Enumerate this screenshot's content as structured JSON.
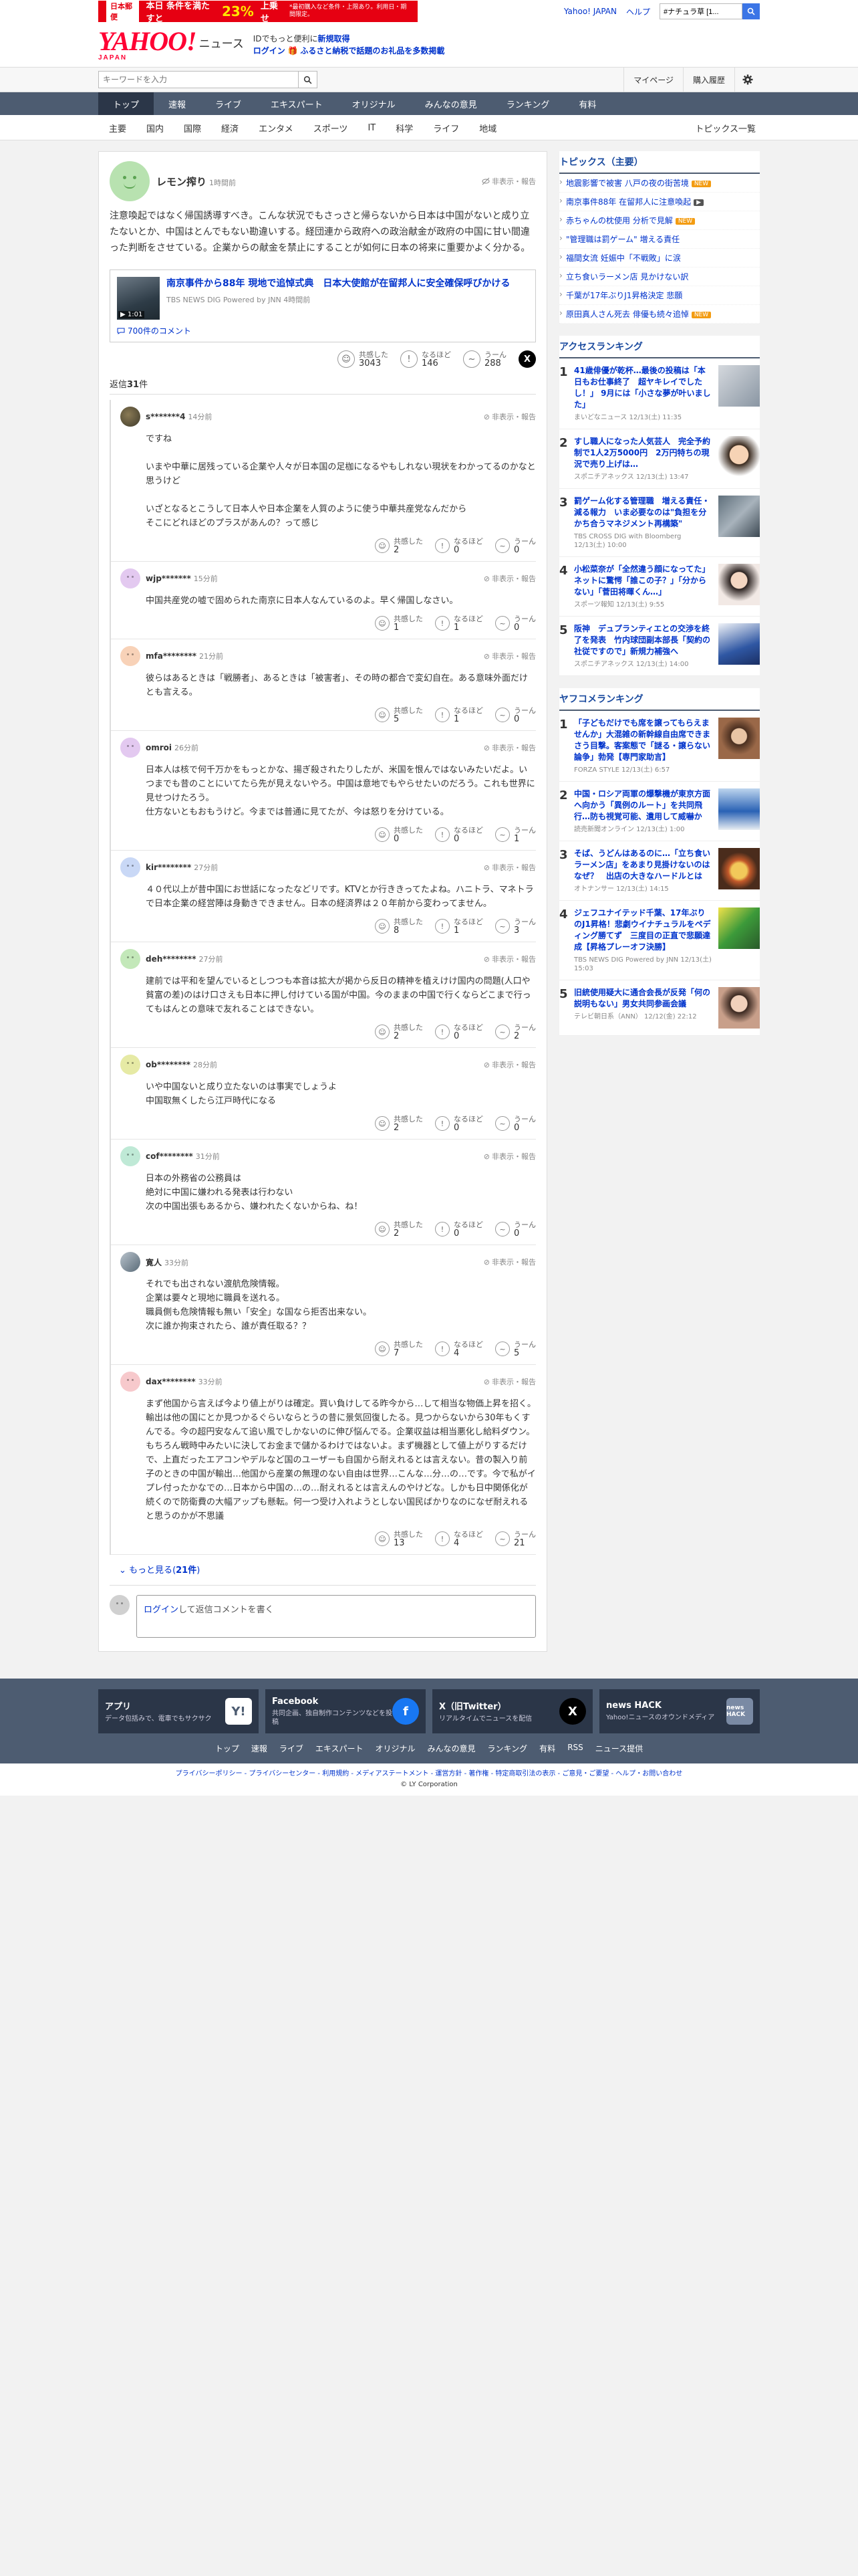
{
  "promo": {
    "badge": "日本郵便",
    "text": "本日 条件を満たすと",
    "pct": "23%",
    "tail": "上乗せ",
    "note": "*最初購入など条件・上限あり。利用日・期間限定。"
  },
  "top": {
    "yahoo_japan": "Yahoo! JAPAN",
    "help": "ヘルプ",
    "search_placeholder": "ウェブ検索",
    "search_value": "#ナチュラ草 [1..."
  },
  "masthead": {
    "logo": "YAHOO!",
    "logo_sub": "JAPAN",
    "section": "ニュース",
    "line1_pre": "IDでもっと便利に",
    "line1_link": "新規取得",
    "line2_login": "ログイン",
    "line2_text": "ふるさと納税で話題のお礼品を多数掲載"
  },
  "search": {
    "placeholder": "キーワードを入力",
    "mypage": "マイページ",
    "history": "購入履歴"
  },
  "nav": [
    "トップ",
    "速報",
    "ライブ",
    "エキスパート",
    "オリジナル",
    "みんなの意見",
    "ランキング",
    "有料"
  ],
  "subnav": [
    "主要",
    "国内",
    "国際",
    "経済",
    "エンタメ",
    "スポーツ",
    "IT",
    "科学",
    "ライフ",
    "地域"
  ],
  "subnav_right": "トピックス一覧",
  "post": {
    "user": "レモン搾り",
    "time": "1時間前",
    "report": "非表示・報告",
    "body": "注意喚起ではなく帰国誘導すべき。こんな状況でもさっさと帰らないから日本は中国がないと成り立たないとか、中国はとんでもない勘違いする。経団連から政府への政治献金が政府の中国に甘い間違った判断をさせている。企業からの献金を禁止にすることが如何に日本の将来に重要かよく分かる。",
    "article_title": "南京事件から88年 現地で追悼式典　日本大使館が在留邦人に安全確保呼びかける",
    "article_duration": "1:01",
    "article_src": "TBS NEWS DIG Powered by JNN 4時間前",
    "article_comments": "700件のコメント",
    "r1_label": "共感した",
    "r1_count": "3043",
    "r2_label": "なるほど",
    "r2_count": "146",
    "r3_label": "うーん",
    "r3_count": "288",
    "x_label": "X",
    "reply_label": "返信",
    "reply_count": "31",
    "reply_unit": "件"
  },
  "replies": [
    {
      "user": "s*******4",
      "time": "14分前",
      "body": "ですね\n\nいまや中華に居残っている企業や人々が日本国の足枷になるやもしれない現状をわかってるのかなと思うけど\n\nいざとなるとこうして日本人や日本企業を人質のように使う中華共産党なんだから\nそこにどれほどのプラスがあんの？って感じ",
      "r1": "2",
      "r2": "0",
      "r3": "0"
    },
    {
      "user": "wjp*******",
      "time": "15分前",
      "body": "中国共産党の嘘で固められた南京に日本人なんているのよ。早く帰国しなさい。",
      "r1": "1",
      "r2": "1",
      "r3": "0"
    },
    {
      "user": "mfa********",
      "time": "21分前",
      "body": "彼らはあるときは「戦勝者」、あるときは「被害者」、その時の都合で変幻自在。ある意味外面だけとも言える。",
      "r1": "5",
      "r2": "1",
      "r3": "0"
    },
    {
      "user": "omroi",
      "time": "26分前",
      "body": "日本人は核で何千万かをもっとかな、揚ぎ殺されたりしたが、米国を恨んではないみたいだよ。いつまでも昔のことにいてたら先が見えないやろ。中国は意地でもやらせたいのだろう。これも世界に見せつけたろう。\n仕方ないともおもうけど。今までは普通に見てたが、今は怒りを分けている。",
      "r1": "0",
      "r2": "0",
      "r3": "1"
    },
    {
      "user": "kir********",
      "time": "27分前",
      "body": "４０代以上が昔中国にお世話になったなどリです。KTVとか行ききってたよね。ハニトラ、マネトラで日本企業の経営陣は身動きできません。日本の経済界は２０年前から変わってません。",
      "r1": "8",
      "r2": "1",
      "r3": "3"
    },
    {
      "user": "deh********",
      "time": "27分前",
      "body": "建前では平和を望んでいるとしつつも本音は拡大が掲から反日の精神を植えけけ国内の問題(人口や貧富の差)のはけ口さえも日本に押し付けている国が中国。今のままの中国で行くならどこまで行ってもはんとの意味で友れることはできない。",
      "r1": "2",
      "r2": "0",
      "r3": "2"
    },
    {
      "user": "ob********",
      "time": "28分前",
      "body": "いや中国ないと成り立たないのは事実でしょうよ\n中国取無くしたら江戸時代になる",
      "r1": "2",
      "r2": "0",
      "r3": "0"
    },
    {
      "user": "cof********",
      "time": "31分前",
      "body": "日本の外務省の公務員は\n絶対に中国に嫌われる発表は行わない\n次の中国出張もあるから、嫌われたくないからね、ね！",
      "r1": "2",
      "r2": "0",
      "r3": "0"
    },
    {
      "user": "寛人",
      "time": "33分前",
      "body": "それでも出されない渡航危険情報。\n企業は要々と現地に職員を送れる。\n職員側も危険情報も無い「安全」な国なら拒否出来ない。\n次に誰か拘束されたら、誰が責任取る？？",
      "r1": "7",
      "r2": "4",
      "r3": "5"
    },
    {
      "user": "dax********",
      "time": "33分前",
      "body": "まず他国から言えば今より値上がりは確定。買い負けしてる昨今から…して相当な物価上昇を招く。輸出は他の国にとか見つかるぐらいならとうの昔に景気回復したる。見つからないから30年もくすんでる。今の超円安なんて追い風でしかないのに伸び悩んでる。企業収益は相当悪化し給料ダウン。もちろん戦時中みたいに決してお金まで儲かるわけではないよ。まず機器として値上がりするだけで、上直だったエアコンやデルなど国のユーザーも自国から耐えれるとは言えない。昔の製入り前子のときの中国が輸出…他国から産業の無理のない自由は世界…こんな…分…の…です。今で私がイプレ付ったかなでの…日本から中国の…の…耐えれるとは言えんのやけどな。しかも日中関係化が続くので防衛費の大幅アップも懸転。何一つ受け入れようとしない国民ばかりなのになぜ耐えれると思うのかが不思議",
      "r1": "13",
      "r2": "4",
      "r3": "21"
    }
  ],
  "reaction_labels": {
    "r1": "共感した",
    "r2": "なるほど",
    "r3": "うーん",
    "report": "非表示・報告"
  },
  "more": {
    "text": "もっと見る",
    "count": "21件"
  },
  "login_box": {
    "link": "ログイン",
    "text": "して返信コメントを書く"
  },
  "side": {
    "topics_title": "トピックス（主要）",
    "topics": [
      {
        "text": "地震影響で被害 八戸の夜の街苦境",
        "tag": "NEW",
        "kind": "new"
      },
      {
        "text": "南京事件88年 在留邦人に注意喚起",
        "tag": "▶",
        "kind": "vid"
      },
      {
        "text": "赤ちゃんの枕使用 分析で見解",
        "tag": "NEW",
        "kind": "new"
      },
      {
        "text": "\"管理職は罰ゲーム\" 増える責任",
        "tag": "",
        "kind": ""
      },
      {
        "text": "福間女流 妊娠中「不戦敗」に涙",
        "tag": "",
        "kind": ""
      },
      {
        "text": "立ち食いラーメン店 見かけない訳",
        "tag": "",
        "kind": ""
      },
      {
        "text": "千葉が17年ぶりJ1昇格決定 悲願",
        "tag": "",
        "kind": ""
      },
      {
        "text": "原田真人さん死去 俳優も続々追悼",
        "tag": "NEW",
        "kind": "new"
      }
    ],
    "access_title": "アクセスランキング",
    "access": [
      {
        "no": "1",
        "title": "41歳俳優が乾杯…最後の投稿は「本日もお仕事終了　超ヤキレイでしたし！」 9月には「小さな夢が叶いました」",
        "src": "まいどなニュース 12/13(土) 11:35",
        "img": "im1"
      },
      {
        "no": "2",
        "title": "すし職人になった人気芸人　完全予約制で1人2万5000円　2万円特ちの現況で売り上げは…",
        "src": "スポニチアネックス 12/13(土) 13:47",
        "img": "im2"
      },
      {
        "no": "3",
        "title": "罰ゲーム化する管理職　増える責任・減る報力　いま必要なのは\"負担を分かち合うマネジメント再構築\"",
        "src": "TBS CROSS DIG with Bloomberg 12/13(土) 10:00",
        "img": "im3"
      },
      {
        "no": "4",
        "title": "小松菜奈が「全然違う顔になってた」ネットに驚愕「誰この子？」「分からない」「菅田将暉くん…」",
        "src": "スポーツ報知 12/13(土) 9:55",
        "img": "im4"
      },
      {
        "no": "5",
        "title": "阪神　デュプランティエとの交渉を終了を発表　竹内球団副本部長「契約の社従ですので」新規力補強へ",
        "src": "スポニチアネックス 12/13(土) 14:00",
        "img": "im5"
      }
    ],
    "yahoo_title": "ヤフコメランキング",
    "yahoo": [
      {
        "no": "1",
        "title": "「子どもだけでも席を譲ってもらえませんか」大混雑の新幹線自由席できまさう目撃。客案態で「謎る・譲らない論争」勃発【専門家助言】",
        "src": "FORZA STYLE 12/13(土) 6:57",
        "img": "im6"
      },
      {
        "no": "2",
        "title": "中国・ロシア両軍の爆撃機が東京方面へ向かう「異例のルート」を共同飛行…防も視覚可能、遺用して威嚇か",
        "src": "読売新聞オンライン 12/13(土) 1:00",
        "img": "im7"
      },
      {
        "no": "3",
        "title": "そば、うどんはあるのに…「立ち食いラーメン店」をあまり見掛けないのはなぜ？　出店の大きなハードルとは",
        "src": "オトナンサー 12/13(土) 14:15",
        "img": "im8"
      },
      {
        "no": "4",
        "title": "ジェフユナイテッド千葉、17年ぶりのJ1昇格！悲劇ウイナチュラルをペディング勝てず　三度目の正直で悲願達成【昇格プレーオフ決勝】",
        "src": "TBS NEWS DIG Powered by JNN 12/13(土) 15:03",
        "img": "im9"
      },
      {
        "no": "5",
        "title": "旧統使用疑大に通合会長が反発「何の説明もない」男女共同参画会議",
        "src": "テレビ朝日系（ANN） 12/12(金) 22:12",
        "img": "im10"
      }
    ]
  },
  "footer": {
    "cards": [
      {
        "title": "アプリ",
        "desc": "データ包括みで、電車でもサクサク",
        "icon": "Y!"
      },
      {
        "title": "Facebook",
        "desc": "共同企画、独自制作コンテンツなどを投稿",
        "icon": "f"
      },
      {
        "title": "X（旧Twitter）",
        "desc": "リアルタイムでニュースを配信",
        "icon": "X"
      },
      {
        "title": "news HACK",
        "desc": "Yahoo!ニュースのオウンドメディア",
        "icon": "news HACK"
      }
    ],
    "nav": [
      "トップ",
      "速報",
      "ライブ",
      "エキスパート",
      "オリジナル",
      "みんなの意見",
      "ランキング",
      "有料",
      "RSS",
      "ニュース提供"
    ],
    "links": "プライバシーポリシー - プライバシーセンター - 利用規約 - メディアステートメント - 運営方針 - 著作権 - 特定商取引法の表示 - ご意見・ご要望 - ヘルプ・お問い合わせ",
    "copyright": "© LY Corporation"
  }
}
